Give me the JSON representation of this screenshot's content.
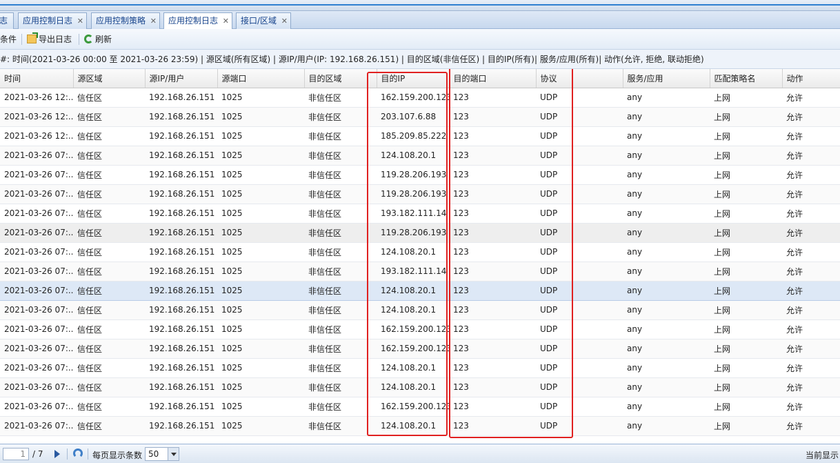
{
  "tabs": [
    {
      "label": "志",
      "closable": false
    },
    {
      "label": "应用控制日志",
      "closable": true
    },
    {
      "label": "应用控制策略",
      "closable": true
    },
    {
      "label": "应用控制日志",
      "closable": true,
      "active": true
    },
    {
      "label": "接口/区域",
      "closable": true
    }
  ],
  "toolbar": {
    "conditions_label": "条件",
    "export_label": "导出日志",
    "refresh_label": "刷新"
  },
  "filter_text": "#: 时间(2021-03-26 00:00 至 2021-03-26 23:59) | 源区域(所有区域) | 源IP/用户(IP: 192.168.26.151) | 目的区域(非信任区) | 目的IP(所有)| 服务/应用(所有)| 动作(允许, 拒绝, 联动拒绝)",
  "columns": [
    "时间",
    "源区域",
    "源IP/用户",
    "源端口",
    "目的区域",
    "目的IP",
    "目的端口",
    "协议",
    "服务/应用",
    "匹配策略名",
    "动作"
  ],
  "rows": [
    [
      "2021-03-26 12:...",
      "信任区",
      "192.168.26.151",
      "1025",
      "非信任区",
      "162.159.200.123",
      "123",
      "UDP",
      "any",
      "上网",
      "允许"
    ],
    [
      "2021-03-26 12:...",
      "信任区",
      "192.168.26.151",
      "1025",
      "非信任区",
      "203.107.6.88",
      "123",
      "UDP",
      "any",
      "上网",
      "允许"
    ],
    [
      "2021-03-26 12:...",
      "信任区",
      "192.168.26.151",
      "1025",
      "非信任区",
      "185.209.85.222",
      "123",
      "UDP",
      "any",
      "上网",
      "允许"
    ],
    [
      "2021-03-26 07:...",
      "信任区",
      "192.168.26.151",
      "1025",
      "非信任区",
      "124.108.20.1",
      "123",
      "UDP",
      "any",
      "上网",
      "允许"
    ],
    [
      "2021-03-26 07:...",
      "信任区",
      "192.168.26.151",
      "1025",
      "非信任区",
      "119.28.206.193",
      "123",
      "UDP",
      "any",
      "上网",
      "允许"
    ],
    [
      "2021-03-26 07:...",
      "信任区",
      "192.168.26.151",
      "1025",
      "非信任区",
      "119.28.206.193",
      "123",
      "UDP",
      "any",
      "上网",
      "允许"
    ],
    [
      "2021-03-26 07:...",
      "信任区",
      "192.168.26.151",
      "1025",
      "非信任区",
      "193.182.111.14",
      "123",
      "UDP",
      "any",
      "上网",
      "允许"
    ],
    [
      "2021-03-26 07:...",
      "信任区",
      "192.168.26.151",
      "1025",
      "非信任区",
      "119.28.206.193",
      "123",
      "UDP",
      "any",
      "上网",
      "允许"
    ],
    [
      "2021-03-26 07:...",
      "信任区",
      "192.168.26.151",
      "1025",
      "非信任区",
      "124.108.20.1",
      "123",
      "UDP",
      "any",
      "上网",
      "允许"
    ],
    [
      "2021-03-26 07:...",
      "信任区",
      "192.168.26.151",
      "1025",
      "非信任区",
      "193.182.111.14",
      "123",
      "UDP",
      "any",
      "上网",
      "允许"
    ],
    [
      "2021-03-26 07:...",
      "信任区",
      "192.168.26.151",
      "1025",
      "非信任区",
      "124.108.20.1",
      "123",
      "UDP",
      "any",
      "上网",
      "允许"
    ],
    [
      "2021-03-26 07:...",
      "信任区",
      "192.168.26.151",
      "1025",
      "非信任区",
      "124.108.20.1",
      "123",
      "UDP",
      "any",
      "上网",
      "允许"
    ],
    [
      "2021-03-26 07:...",
      "信任区",
      "192.168.26.151",
      "1025",
      "非信任区",
      "162.159.200.123",
      "123",
      "UDP",
      "any",
      "上网",
      "允许"
    ],
    [
      "2021-03-26 07:...",
      "信任区",
      "192.168.26.151",
      "1025",
      "非信任区",
      "162.159.200.123",
      "123",
      "UDP",
      "any",
      "上网",
      "允许"
    ],
    [
      "2021-03-26 07:...",
      "信任区",
      "192.168.26.151",
      "1025",
      "非信任区",
      "124.108.20.1",
      "123",
      "UDP",
      "any",
      "上网",
      "允许"
    ],
    [
      "2021-03-26 07:...",
      "信任区",
      "192.168.26.151",
      "1025",
      "非信任区",
      "124.108.20.1",
      "123",
      "UDP",
      "any",
      "上网",
      "允许"
    ],
    [
      "2021-03-26 07:...",
      "信任区",
      "192.168.26.151",
      "1025",
      "非信任区",
      "162.159.200.123",
      "123",
      "UDP",
      "any",
      "上网",
      "允许"
    ],
    [
      "2021-03-26 07:...",
      "信任区",
      "192.168.26.151",
      "1025",
      "非信任区",
      "124.108.20.1",
      "123",
      "UDP",
      "any",
      "上网",
      "允许"
    ]
  ],
  "pager": {
    "page": "1",
    "total_pages": "/ 7",
    "per_page_label": "每页显示条数",
    "per_page_value": "50",
    "status_text": "当前显示"
  },
  "colors": {
    "highlight_box": "#e02020",
    "tab_text": "#15428b"
  }
}
